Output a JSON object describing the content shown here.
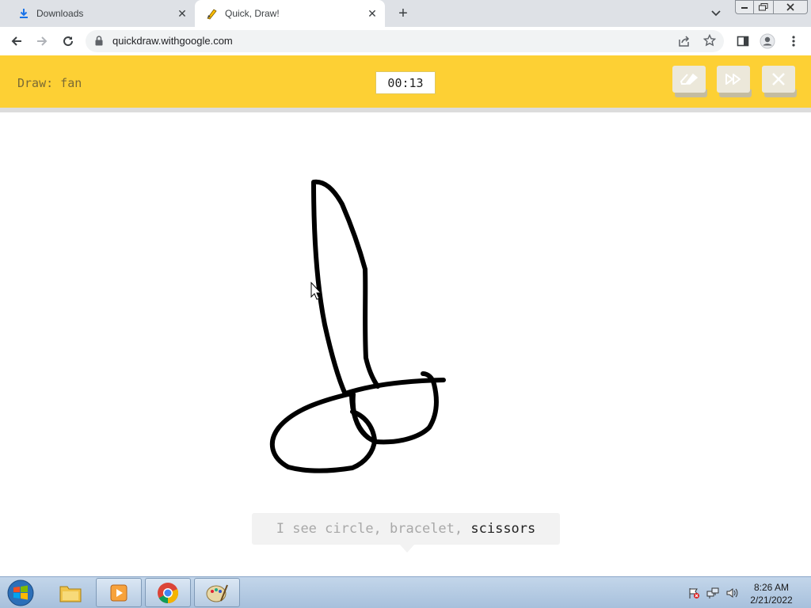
{
  "browser": {
    "tabs": [
      {
        "title": "Downloads",
        "icon": "download-icon",
        "active": false
      },
      {
        "title": "Quick, Draw!",
        "icon": "quickdraw-favicon",
        "active": true
      }
    ],
    "url": "quickdraw.withgoogle.com"
  },
  "game": {
    "prompt": "Draw: fan",
    "timer": "00:13",
    "buttons": [
      "eraser-icon",
      "skip-icon",
      "close-icon"
    ],
    "guess_prefix": "I see circle, bracelet, ",
    "guess_current": "scissors",
    "colors": {
      "header": "#fdd034",
      "ink": "#000000"
    }
  },
  "taskbar": {
    "apps": [
      "windows-explorer-icon",
      "media-player-icon",
      "chrome-icon",
      "paint-icon"
    ],
    "clock": {
      "time": "8:26 AM",
      "date": "2/21/2022"
    }
  }
}
